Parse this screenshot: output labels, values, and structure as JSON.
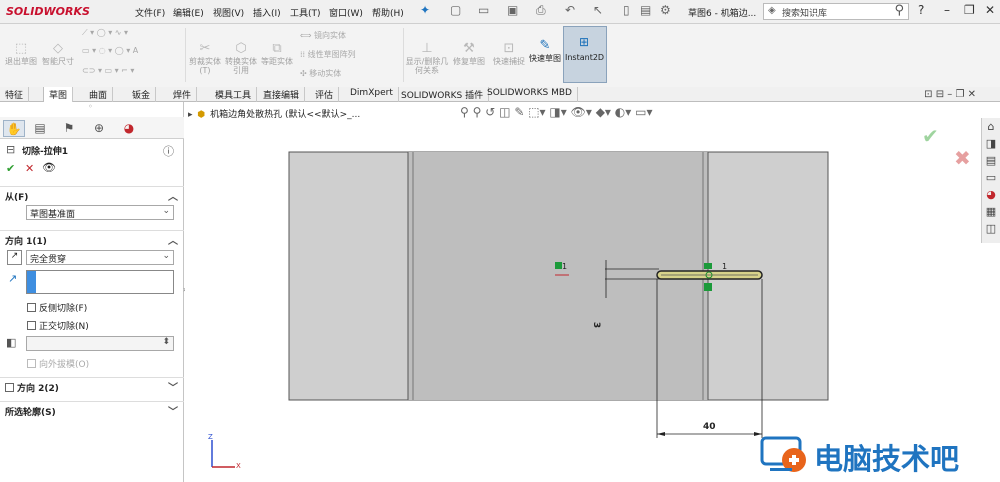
{
  "app": {
    "logo": "SOLIDWORKS",
    "doc_title": "草图6 - 机箱边..."
  },
  "menus": [
    "文件(F)",
    "编辑(E)",
    "视图(V)",
    "插入(I)",
    "工具(T)",
    "窗口(W)",
    "帮助(H)"
  ],
  "search": {
    "placeholder": "搜索知识库"
  },
  "ribbon": {
    "exit_sketch": "退出草图",
    "smart_dim": "智能尺寸",
    "trim": "剪裁实体(T)",
    "convert": "转换实体引用",
    "offset": "等距实体",
    "mirror": "镜向实体",
    "linear_pattern": "线性草图阵列",
    "move": "移动实体",
    "display_delete": "显示/删除几何关系",
    "repair": "修复草图",
    "quick_snap": "快速捕捉",
    "rapid_sketch": "快速草图",
    "instant2d": "Instant2D"
  },
  "tabs": [
    "特征",
    "草图",
    "曲面",
    "钣金",
    "焊件",
    "模具工具",
    "直接编辑",
    "评估",
    "DimXpert",
    "SOLIDWORKS 插件",
    "SOLIDWORKS MBD"
  ],
  "active_tab": "草图",
  "property_manager": {
    "title": "切除-拉伸1",
    "from_label": "从(F)",
    "from_value": "草图基准面",
    "dir1_label": "方向 1(1)",
    "dir1_value": "完全贯穿",
    "flip_side": "反侧切除(F)",
    "normal_cut": "正交切除(N)",
    "draft_outward": "向外拔模(O)",
    "dir2_label": "方向 2(2)",
    "selected_contours": "所选轮廓(S)"
  },
  "graphics": {
    "hud_path": "机箱边角处散热孔 (默认<<默认>_...",
    "dimension_40": "40",
    "dimension_vertical": "3",
    "sketch_label": "1",
    "triad_z": "Z",
    "triad_x": "X"
  },
  "watermark": "电脑技术吧"
}
